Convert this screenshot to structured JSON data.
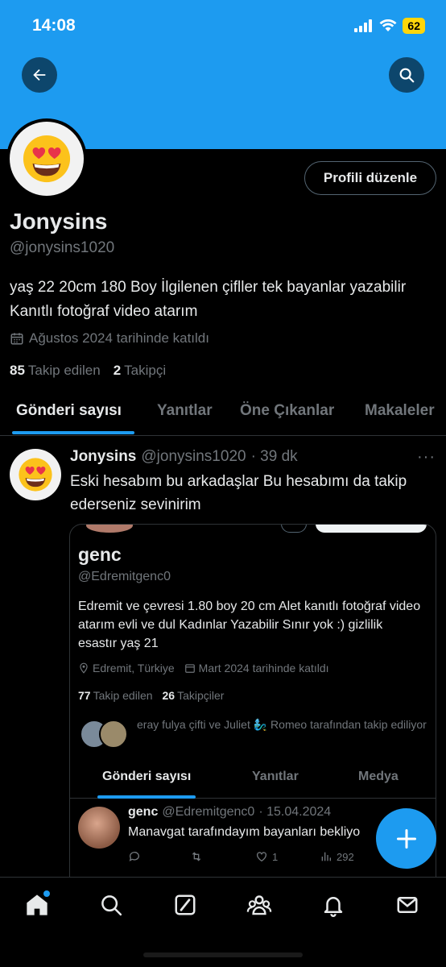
{
  "status_bar": {
    "time": "14:08",
    "battery": "62"
  },
  "colors": {
    "accent": "#1d9bf0",
    "background": "#000000",
    "secondary_text": "#71767b"
  },
  "header": {
    "back_icon": "arrow-left-icon",
    "search_icon": "search-icon"
  },
  "profile": {
    "avatar_emoji": "😍",
    "edit_button": "Profili düzenle",
    "name": "Jonysins",
    "handle": "@jonysins1020",
    "bio": "yaş 22 20cm 180 Boy İlgilenen çifller tek bayanlar yazabilir Kanıtlı fotoğraf video atarım",
    "joined": "Ağustos 2024 tarihinde katıldı",
    "following_count": "85",
    "following_label": "Takip edilen",
    "followers_count": "2",
    "followers_label": "Takipçi"
  },
  "tabs": [
    "Gönderi sayısı",
    "Yanıtlar",
    "Öne Çıkanlar",
    "Makaleler"
  ],
  "post": {
    "avatar_emoji": "😍",
    "name": "Jonysins",
    "handle": "@jonysins1020",
    "time": "· 39 dk",
    "more": "···",
    "text": "Eski hesabım bu arkadaşlar Bu hesabımı da takip ederseniz sevinirim",
    "embed": {
      "name": "genc",
      "handle": "@Edremitgenc0",
      "bio": "Edremit ve çevresi 1.80 boy 20 cm Alet kanıtlı fotoğraf video atarım evli ve dul Kadınlar Yazabilir Sınır yok :) gizlilik esastır yaş 21",
      "location": "Edremit, Türkiye",
      "joined": "Mart 2024 tarihinde katıldı",
      "following_count": "77",
      "following_label": "Takip edilen",
      "followers_count": "26",
      "followers_label": "Takipçiler",
      "followed_by": "eray fulya çifti ve Juliet 🧞‍♂️ Romeo tarafından takip ediliyor",
      "tabs": [
        "Gönderi sayısı",
        "Yanıtlar",
        "Medya"
      ],
      "inner_post": {
        "name": "genc",
        "handle": "@Edremitgenc0",
        "date": "· 15.04.2024",
        "text": "Manavgat tarafındayım bayanları bekliyo",
        "likes": "1",
        "views": "292"
      }
    }
  },
  "nav": [
    "home-icon",
    "search-icon",
    "grok-icon",
    "communities-icon",
    "notifications-icon",
    "messages-icon"
  ]
}
